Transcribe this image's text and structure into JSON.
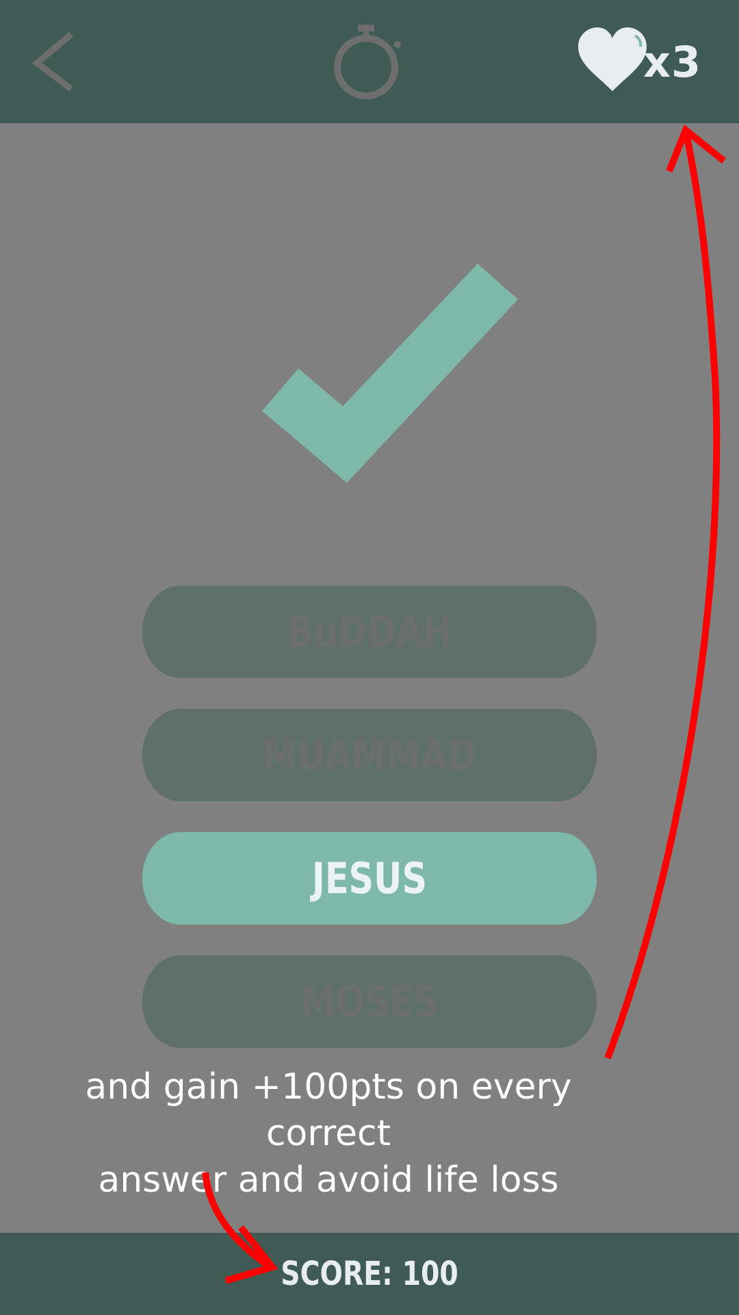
{
  "header": {
    "back_icon": "chevron-left-icon",
    "timer_icon": "stopwatch-icon",
    "lives_icon": "heart-icon",
    "lives_count": "x3"
  },
  "feedback": {
    "icon": "checkmark-icon",
    "color": "#7db8a9"
  },
  "answers": [
    {
      "label": "BuDDAH",
      "state": "disabled"
    },
    {
      "label": "MUAMMAD",
      "state": "disabled"
    },
    {
      "label": "JESUS",
      "state": "correct"
    },
    {
      "label": "MOSES",
      "state": "disabled"
    }
  ],
  "annotation": {
    "line1": "and gain +100pts on every correct",
    "line2": "answer and avoid life loss",
    "arrow_color": "#ff0000"
  },
  "footer": {
    "score_label": "SCORE: 100"
  },
  "colors": {
    "bar": "#405b54",
    "overlay": "#808080",
    "accent": "#7db8a9"
  }
}
